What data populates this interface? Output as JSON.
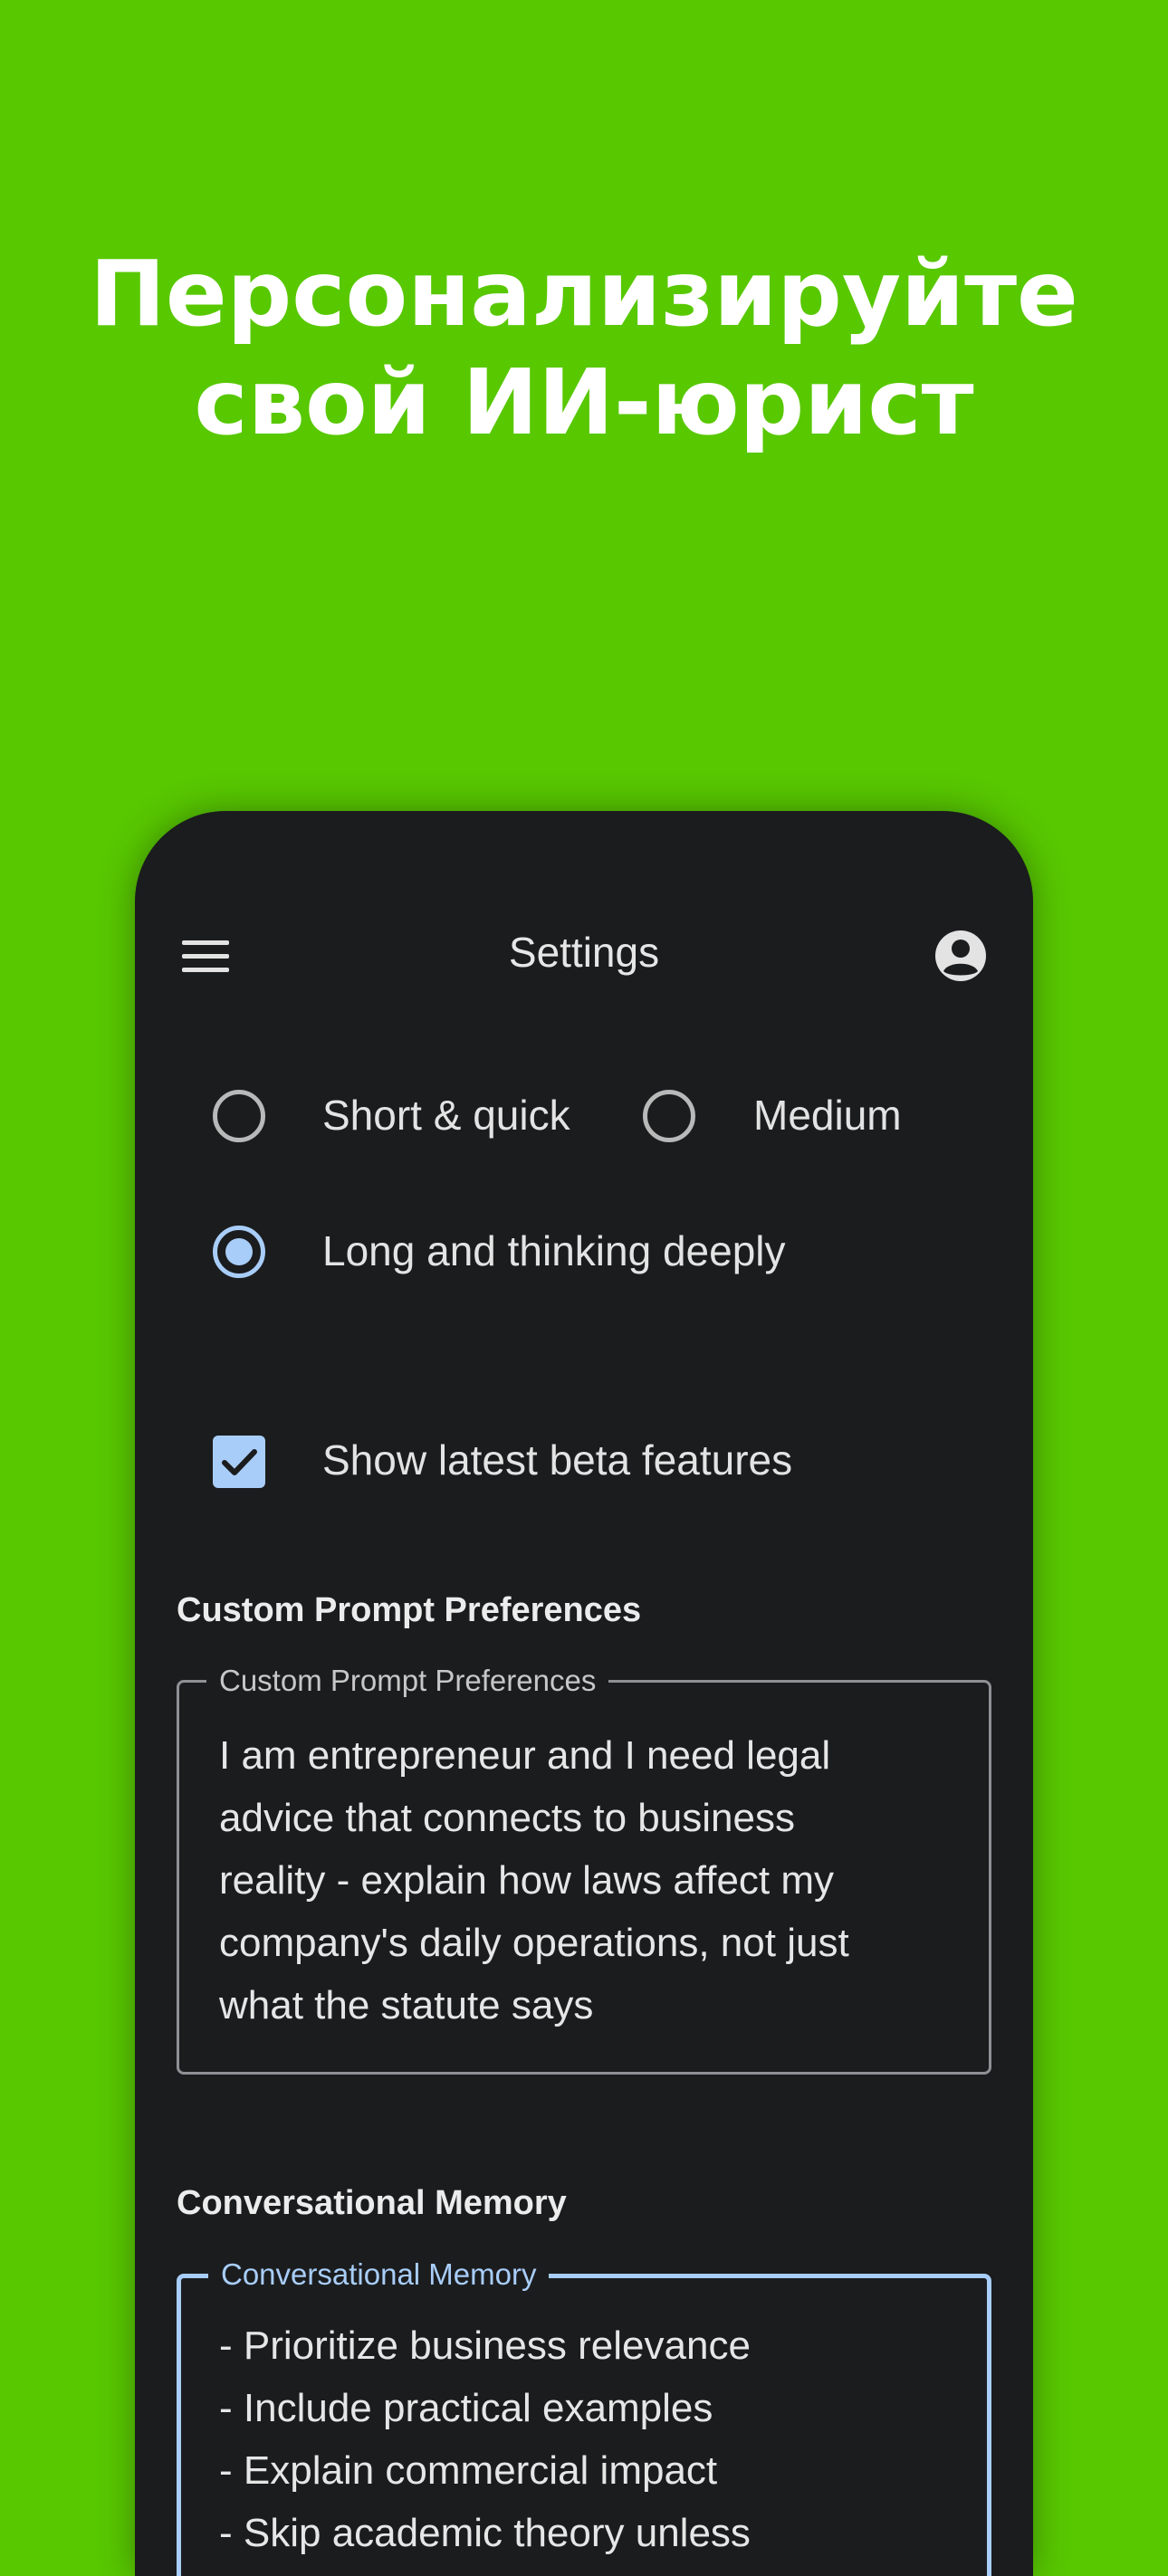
{
  "headline": {
    "line1": "Персонализируйте",
    "line2": "свой ИИ-юрист"
  },
  "appbar": {
    "title": "Settings",
    "menu_icon": "menu-icon",
    "account_icon": "account-circle-icon"
  },
  "response_length": {
    "options": [
      {
        "label": "Short & quick",
        "selected": false
      },
      {
        "label": "Medium",
        "selected": false
      },
      {
        "label": "Long and thinking deeply",
        "selected": true
      }
    ]
  },
  "beta": {
    "label": "Show latest beta features",
    "checked": true
  },
  "custom_prompt": {
    "section_title": "Custom Prompt Preferences",
    "field_label": "Custom Prompt Preferences",
    "value": "I am entrepreneur and I  need legal\nadvice that connects to business\nreality - explain how laws affect my\ncompany's daily operations, not just\nwhat the statute says"
  },
  "memory": {
    "section_title": "Conversational Memory",
    "field_label": "Conversational Memory",
    "value": "- Prioritize business relevance\n- Include practical examples\n- Explain commercial impact\n- Skip academic theory unless"
  },
  "colors": {
    "background": "#58c800",
    "surface": "#1b1c1e",
    "accent": "#a8cdf8"
  }
}
